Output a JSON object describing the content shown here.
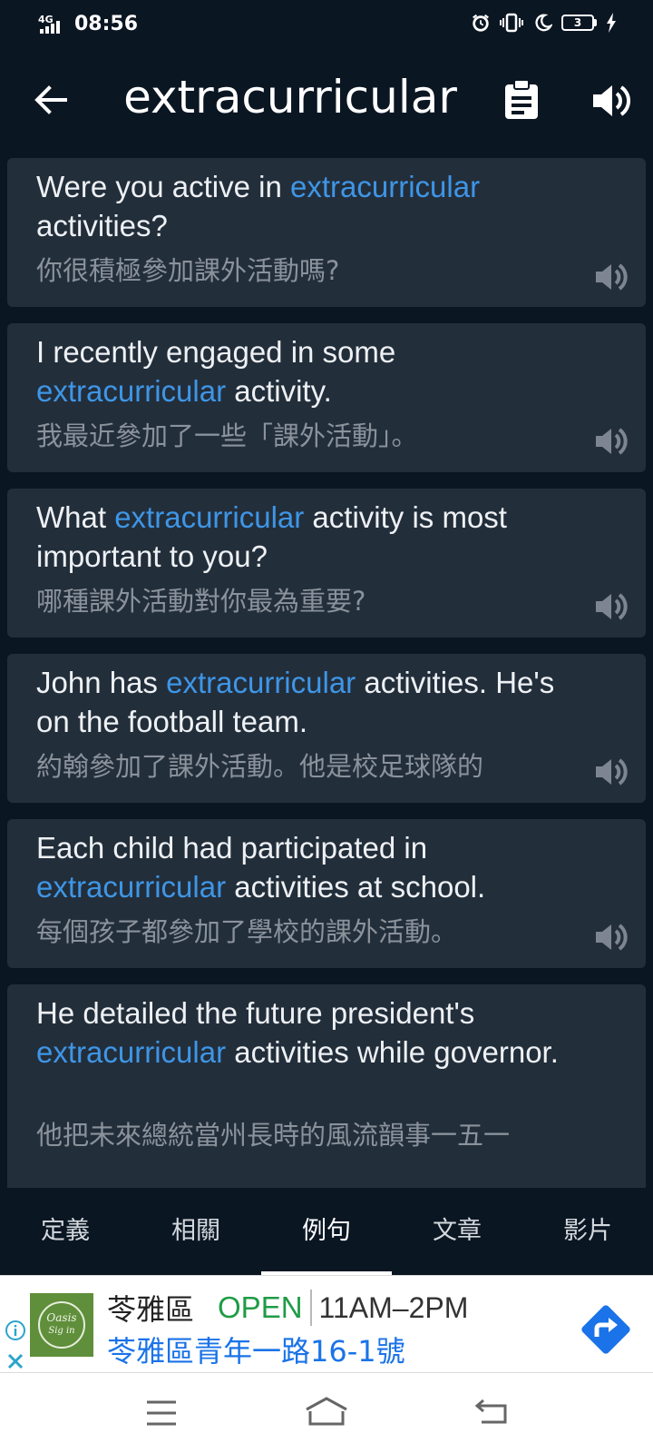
{
  "status_bar": {
    "network": "4G",
    "time": "08:56",
    "battery": "3",
    "icons": [
      "signal-icon",
      "alarm-icon",
      "vibrate-icon",
      "moon-icon",
      "battery-icon",
      "charging-icon"
    ]
  },
  "header": {
    "word": "extracurricular",
    "icons": [
      "back-arrow-icon",
      "clipboard-icon",
      "speaker-icon"
    ]
  },
  "examples": [
    {
      "en": [
        {
          "text": "Were you active in ",
          "hl": false
        },
        {
          "text": "extracurricular",
          "hl": true
        },
        {
          "text": " activities?",
          "hl": false
        }
      ],
      "zh": "你很積極參加課外活動嗎?"
    },
    {
      "en": [
        {
          "text": "I recently engaged in some ",
          "hl": false
        },
        {
          "text": "extracurricular",
          "hl": true
        },
        {
          "text": " activity.",
          "hl": false
        }
      ],
      "zh": "我最近參加了一些「課外活動」。"
    },
    {
      "en": [
        {
          "text": "What ",
          "hl": false
        },
        {
          "text": "extracurricular",
          "hl": true
        },
        {
          "text": " activity is most important to you?",
          "hl": false
        }
      ],
      "zh": "哪種課外活動對你最為重要?"
    },
    {
      "en": [
        {
          "text": "John has ",
          "hl": false
        },
        {
          "text": "extracurricular",
          "hl": true
        },
        {
          "text": " activities. He's on the football team.",
          "hl": false
        }
      ],
      "zh": "約翰參加了課外活動。他是校足球隊的"
    },
    {
      "en": [
        {
          "text": "Each child had participated in ",
          "hl": false
        },
        {
          "text": "extracurricular",
          "hl": true
        },
        {
          "text": " activities at school.",
          "hl": false
        }
      ],
      "zh": "每個孩子都參加了學校的課外活動。"
    },
    {
      "en": [
        {
          "text": "He detailed the future president's ",
          "hl": false
        },
        {
          "text": "extracurricular",
          "hl": true
        },
        {
          "text": " activities while governor.",
          "hl": false
        }
      ],
      "zh": "他把未來總統當州長時的風流韻事一五一"
    }
  ],
  "tabs": [
    {
      "label": "定義",
      "active": false
    },
    {
      "label": "相關",
      "active": false
    },
    {
      "label": "例句",
      "active": true
    },
    {
      "label": "文章",
      "active": false
    },
    {
      "label": "影片",
      "active": false
    }
  ],
  "ad": {
    "name": "苓雅區",
    "status": "OPEN",
    "hours": "11AM–2PM",
    "address": "苓雅區青年一路16-1號",
    "logo_text": [
      "Oasis",
      "Sig in"
    ],
    "status_color": "#1e9c46",
    "address_color": "#1a73e8",
    "icons": [
      "ad-info-icon",
      "ad-close-icon",
      "directions-icon"
    ]
  },
  "nav": {
    "icons": [
      "menu-icon",
      "home-icon",
      "back-icon"
    ]
  },
  "colors": {
    "background": "#0b1623",
    "card": "#232e3b",
    "highlight": "#3e96e6",
    "translation": "#8a929b"
  }
}
